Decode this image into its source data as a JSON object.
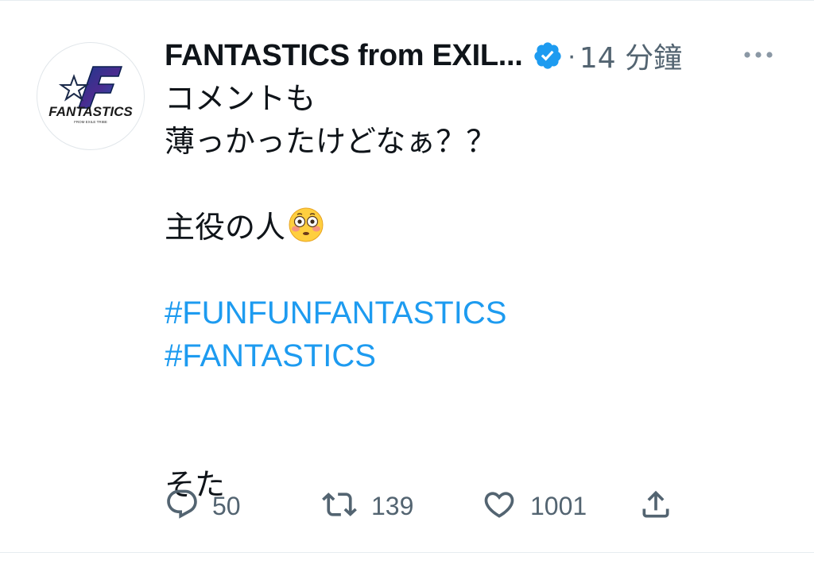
{
  "tweet": {
    "author": {
      "display_name": "FANTASTICS from EXIL...",
      "avatar_text": "FANTASTICS",
      "avatar_subtext": "FROM EXILE TRIBE",
      "verified": true
    },
    "separator": "·",
    "time": "14 分鐘",
    "body": {
      "line1": "コメントも",
      "line2": "薄っかったけどなぁ？？",
      "line3": "主役の人",
      "line3_emoji": "flushed-face-emoji",
      "hashtag1": "#FUNFUNFANTASTICS",
      "hashtag2": "#FANTASTICS",
      "signature": "そた"
    },
    "actions": {
      "reply_count": "50",
      "retweet_count": "139",
      "like_count": "1001"
    }
  },
  "colors": {
    "text": "#0f1419",
    "muted": "#536471",
    "link": "#1d9bf0",
    "verified": "#1d9bf0",
    "divider": "#e6ecf0"
  },
  "icons": {
    "more": "more-horizontal-icon",
    "reply": "reply-icon",
    "retweet": "retweet-icon",
    "like": "heart-icon",
    "share": "share-icon",
    "verified": "verified-badge-icon"
  }
}
